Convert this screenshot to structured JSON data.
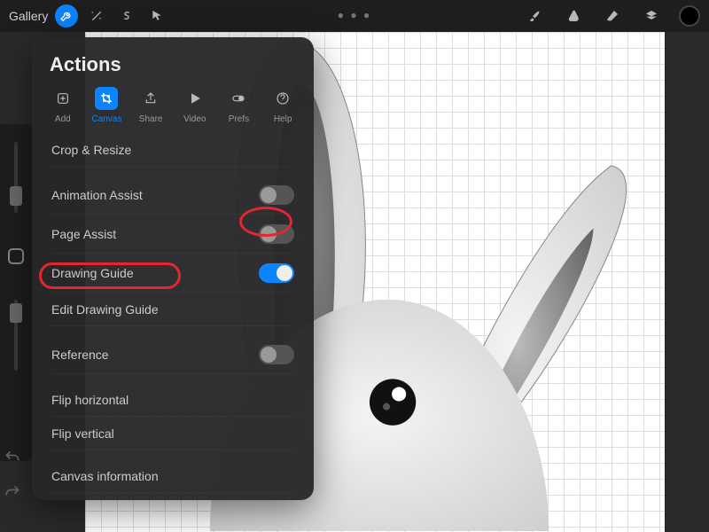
{
  "topbar": {
    "gallery": "Gallery"
  },
  "colors": {
    "accent": "#0a84ff",
    "highlight": "#e3262f",
    "swatch": "#000000"
  },
  "popover": {
    "title": "Actions",
    "tabs": [
      {
        "label": "Add"
      },
      {
        "label": "Canvas"
      },
      {
        "label": "Share"
      },
      {
        "label": "Video"
      },
      {
        "label": "Prefs"
      },
      {
        "label": "Help"
      }
    ],
    "active_tab": "Canvas",
    "items": {
      "crop": "Crop & Resize",
      "anim": "Animation Assist",
      "page": "Page Assist",
      "guide": "Drawing Guide",
      "edit_guide": "Edit Drawing Guide",
      "reference": "Reference",
      "flip_h": "Flip horizontal",
      "flip_v": "Flip vertical",
      "info": "Canvas information"
    },
    "toggles": {
      "anim": false,
      "page": false,
      "guide": true,
      "reference": false
    }
  },
  "canvas": {
    "subject": "rabbit sketch",
    "guide": "2D grid"
  }
}
